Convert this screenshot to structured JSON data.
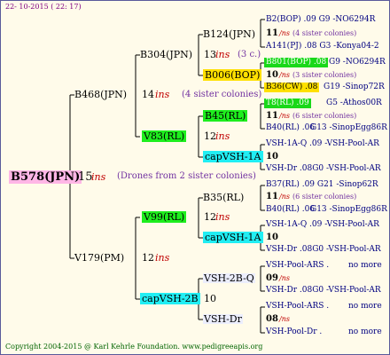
{
  "header": {
    "date": "22- 10-2015 ( 22: 17)"
  },
  "footer": {
    "copyright": "Copyright 2004-2015 @ Karl Kehrle Foundation.   www.pedigreeapis.org"
  },
  "root": {
    "name": "B578(JPN)",
    "num": "15",
    "ins": "ins",
    "note": "(Drones from 2 sister colonies)"
  },
  "sire": {
    "name": "B468(JPN)",
    "num": "14",
    "ins": "ins",
    "note": "(4 sister colonies)"
  },
  "dam": {
    "name": "V179(PM)",
    "num": "12",
    "ins": "ins"
  },
  "b304": {
    "name": "B304(JPN)",
    "num": "13",
    "ins": "ins",
    "note": "(3 c.)"
  },
  "v83": {
    "name": "V83(RL)",
    "num": "12",
    "ins": "ins"
  },
  "v99": {
    "name": "V99(RL)",
    "num": "12",
    "ins": "ins"
  },
  "cap2b_top": {
    "name": "capVSH-2B",
    "num": "10"
  },
  "b124": {
    "name": "B124(JPN)",
    "num": "11",
    "ins": "/ns",
    "note": "(4 sister colonies)"
  },
  "b006": {
    "name": "B006(BOP)",
    "num": "10",
    "ins": "/ns",
    "note": "(3 sister colonies)"
  },
  "b45": {
    "name": "B45(RL)",
    "num": "11",
    "ins": "/ns",
    "note": "(6 sister colonies)"
  },
  "cap1a_1": {
    "name": "capVSH-1A",
    "num": "10"
  },
  "b35": {
    "name": "B35(RL)",
    "num": "11",
    "ins": "/ns",
    "note": "(6 sister colonies)"
  },
  "cap1a_2": {
    "name": "capVSH-1A",
    "num": "10"
  },
  "vsh2bq": {
    "name": "VSH-2B-Q",
    "num": "09",
    "ins": "/ns"
  },
  "vshdr": {
    "name": "VSH-Dr",
    "num": "08",
    "ins": "/ns"
  },
  "right": [
    "B2(BOP) .09       G9 -NO6294R",
    "A141(PJ) .08    G3 -Konya04-2",
    "B801(BOP) .08",
    "G9 -NO6294R",
    "B36(CW) .08",
    "G19 -Sinop72R",
    "T8(RL) .09",
    "G5 -Athos00R",
    "B40(RL) .06",
    "G13 -SinopEgg86R",
    "VSH-1A-Q .09 -VSH-Pool-AR",
    "VSH-Dr .08G0 -VSH-Pool-AR",
    "B37(RL) .09     G21 -Sinop62R",
    "B40(RL) .06",
    "G13 -SinopEgg86R",
    "VSH-1A-Q .09 -VSH-Pool-AR",
    "VSH-Dr .08G0 -VSH-Pool-AR",
    "VSH-Pool-ARS .",
    "no more",
    "VSH-Dr .08G0 -VSH-Pool-AR",
    "VSH-Pool-ARS .",
    "no more",
    "VSH-Pool-Dr .",
    "no more"
  ]
}
